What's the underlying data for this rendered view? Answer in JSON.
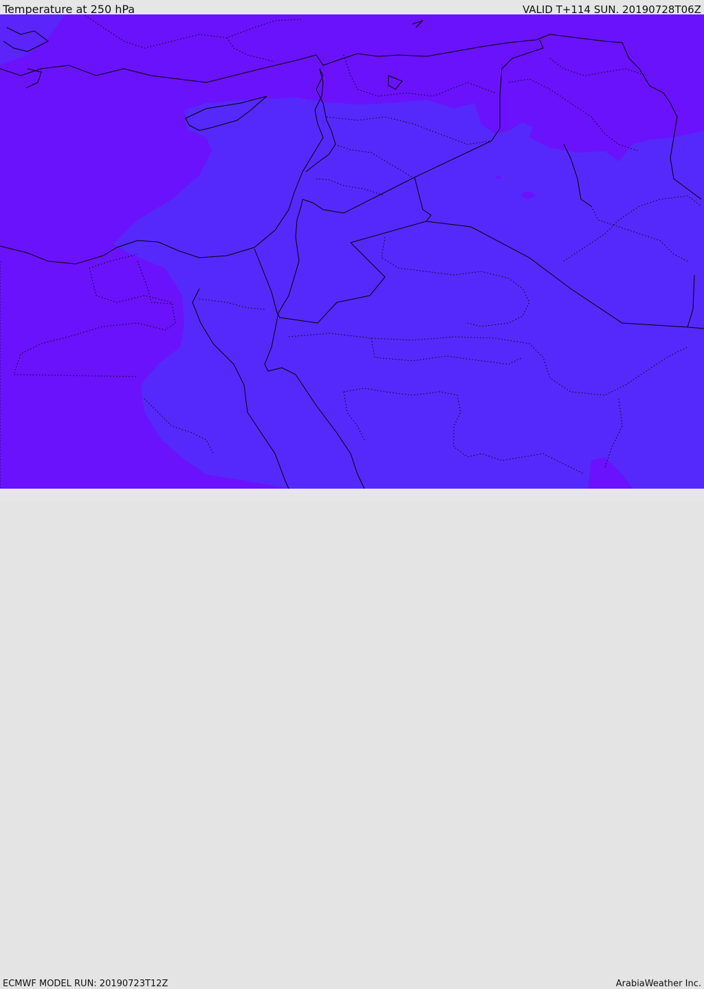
{
  "header": {
    "title": "Temperature at 250 hPa",
    "valid": "VALID T+114 SUN. 20190728T06Z"
  },
  "footer": {
    "model_run": "ECMWF MODEL RUN: 20190723T12Z",
    "credit": "ArabiaWeather Inc."
  },
  "colors": {
    "field_warm": "#6a12fb",
    "field_cool": "#5529fb",
    "field_cool_edge": "#5a24fb",
    "coastline": "#000000",
    "borders": "#000000",
    "bars": "#e6e6e6"
  }
}
